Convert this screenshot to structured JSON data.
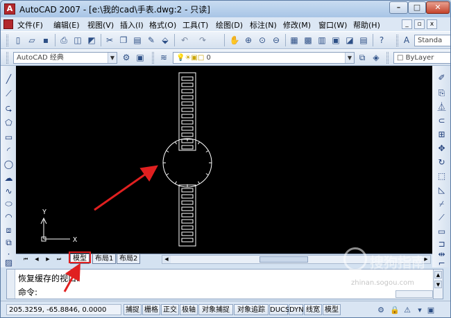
{
  "window": {
    "title": "AutoCAD 2007 - [e:\\我的cad\\手表.dwg:2 - 只读]",
    "app_icon": "A",
    "buttons": {
      "minimize": "–",
      "maximize": "□",
      "close": "✕"
    }
  },
  "menubar": {
    "items": [
      "文件(F)",
      "编辑(E)",
      "视图(V)",
      "插入(I)",
      "格式(O)",
      "工具(T)",
      "绘图(D)",
      "标注(N)",
      "修改(M)",
      "窗口(W)",
      "帮助(H)"
    ],
    "mdi_buttons": [
      "_",
      "▫",
      "x"
    ]
  },
  "toolbar_standard": {
    "text_style_label": "Standa"
  },
  "toolbar_layers": {
    "workspace": "AutoCAD 经典",
    "layer": "0",
    "bylayer": "ByLayer"
  },
  "left_tools": [
    "line-icon",
    "construction-line-icon",
    "polyline-icon",
    "polygon-icon",
    "rectangle-icon",
    "arc-icon",
    "circle-icon",
    "revision-cloud-icon",
    "spline-icon",
    "ellipse-icon",
    "ellipse-arc-icon",
    "insert-block-icon",
    "make-block-icon",
    "point-icon",
    "hatch-icon"
  ],
  "right_tools": [
    "erase-icon",
    "copy-icon",
    "mirror-icon",
    "offset-icon",
    "array-icon",
    "move-icon",
    "rotate-icon",
    "scale-icon",
    "stretch-icon",
    "trim-icon",
    "extend-icon",
    "break-icon",
    "join-icon",
    "chamfer-icon",
    "fillet-icon"
  ],
  "drawing": {
    "background": "#000000",
    "ucs": {
      "x_label": "X",
      "y_label": "Y"
    }
  },
  "layout_tabs": {
    "tabs": [
      "模型",
      "布局1",
      "布局2"
    ],
    "active": "模型",
    "nav": [
      "⏮",
      "◀",
      "▶",
      "⏭"
    ]
  },
  "command": {
    "history": "恢复缓存的视口.",
    "prompt": "命令:"
  },
  "statusbar": {
    "coordinates": "205.3259, -65.8846, 0.0000",
    "buttons": [
      "捕捉",
      "栅格",
      "正交",
      "极轴",
      "对象捕捉",
      "对象追踪",
      "DUCS",
      "DYN",
      "线宽",
      "模型"
    ]
  },
  "watermark": {
    "text": "搜狗指南",
    "url": "zhinan.sogou.com"
  },
  "annotation": {
    "color": "#e02020"
  }
}
